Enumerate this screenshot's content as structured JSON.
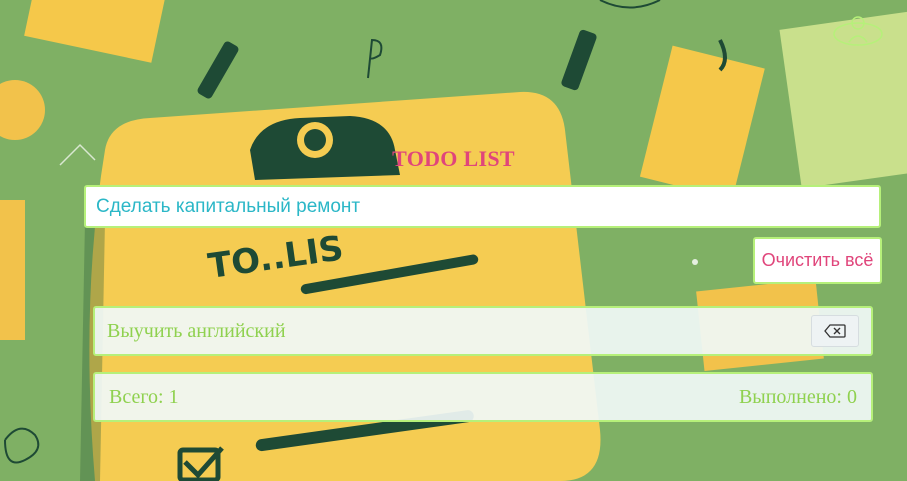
{
  "header": {
    "title": "TODO LIST"
  },
  "form": {
    "input_value": "Сделать капитальный ремонт",
    "clear_label": "Очистить всё"
  },
  "tasks": [
    {
      "text": "Выучить английский"
    }
  ],
  "stats": {
    "total_label": "Всего: 1",
    "done_label": "Выполнено: 0"
  },
  "icons": {
    "delete": "backspace-icon",
    "user": "user-icon"
  },
  "colors": {
    "background": "#7fb064",
    "accent_pink": "#e0457b",
    "accent_green": "#8fd14f",
    "border_green": "#b6f07a",
    "input_text": "#2bb7c7"
  }
}
